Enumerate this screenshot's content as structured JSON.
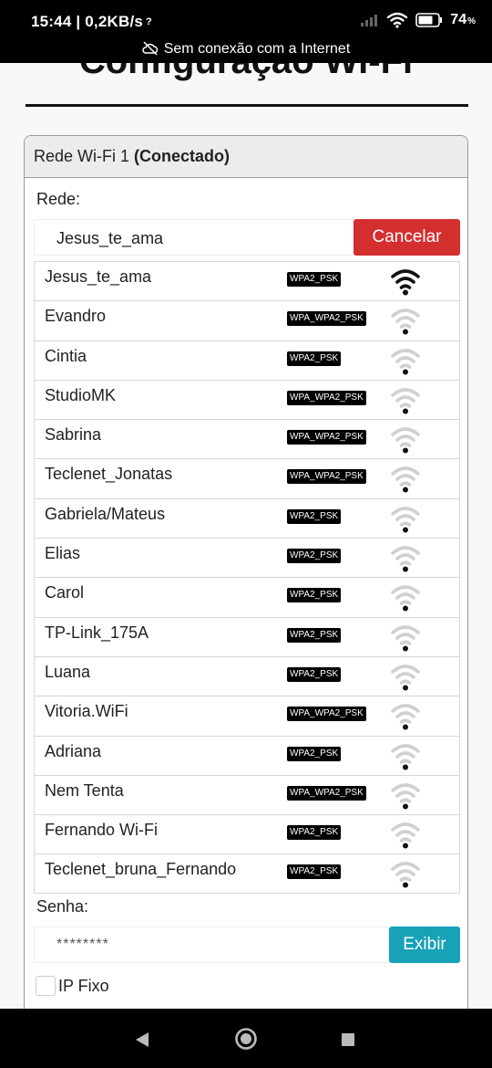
{
  "status_bar": {
    "time_speed": "15:44 | 0,2KB/s",
    "battery": "74",
    "battery_unit": "%"
  },
  "offline_banner": "Sem conexão com a Internet",
  "page_title": "Configuração Wi-Fi",
  "card": {
    "header_prefix": "Rede Wi-Fi 1",
    "header_status": "(Conectado)",
    "network_label": "Rede:",
    "network_value": "Jesus_te_ama",
    "cancel_label": "Cancelar",
    "networks": [
      {
        "name": "Jesus_te_ama",
        "security": "WPA2_PSK",
        "signal": 4
      },
      {
        "name": "Evandro",
        "security": "WPA_WPA2_PSK",
        "signal": 1
      },
      {
        "name": "Cintia",
        "security": "WPA2_PSK",
        "signal": 1
      },
      {
        "name": "StudioMK",
        "security": "WPA_WPA2_PSK",
        "signal": 1
      },
      {
        "name": "Sabrina",
        "security": "WPA_WPA2_PSK",
        "signal": 1
      },
      {
        "name": "Teclenet_Jonatas",
        "security": "WPA_WPA2_PSK",
        "signal": 1
      },
      {
        "name": "Gabriela/Mateus",
        "security": "WPA2_PSK",
        "signal": 1
      },
      {
        "name": "Elias",
        "security": "WPA2_PSK",
        "signal": 1
      },
      {
        "name": "Carol",
        "security": "WPA2_PSK",
        "signal": 1
      },
      {
        "name": "TP-Link_175A",
        "security": "WPA2_PSK",
        "signal": 1
      },
      {
        "name": "Luana",
        "security": "WPA2_PSK",
        "signal": 1
      },
      {
        "name": "Vitoria.WiFi",
        "security": "WPA_WPA2_PSK",
        "signal": 1
      },
      {
        "name": "Adriana",
        "security": "WPA2_PSK",
        "signal": 1
      },
      {
        "name": "Nem Tenta",
        "security": "WPA_WPA2_PSK",
        "signal": 1
      },
      {
        "name": "Fernando Wi-Fi",
        "security": "WPA2_PSK",
        "signal": 1
      },
      {
        "name": "Teclenet_bruna_Fernando",
        "security": "WPA2_PSK",
        "signal": 1
      }
    ],
    "password_label": "Senha:",
    "password_value": "********",
    "show_label": "Exibir",
    "fixed_ip_label": "IP Fixo"
  }
}
